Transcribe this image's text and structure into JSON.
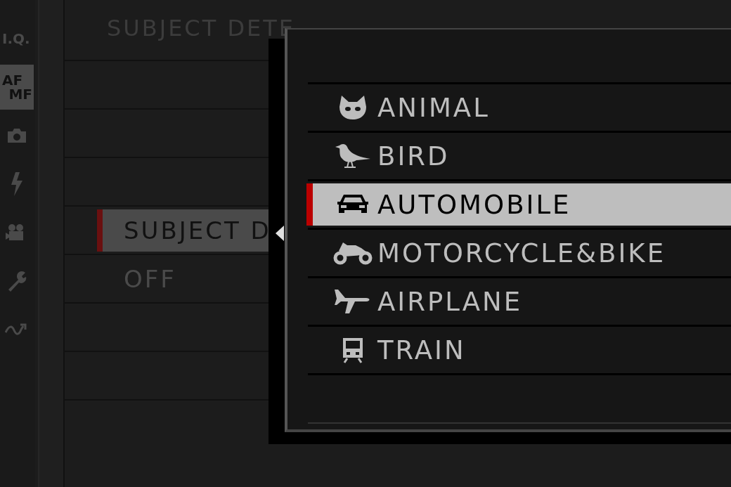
{
  "sidebar": {
    "items": [
      {
        "kind": "text",
        "lines": [
          "I.Q."
        ],
        "selected": false
      },
      {
        "kind": "text",
        "lines": [
          "AF",
          "MF"
        ],
        "selected": true
      },
      {
        "kind": "camera",
        "selected": false
      },
      {
        "kind": "flash",
        "selected": false
      },
      {
        "kind": "movie",
        "selected": false
      },
      {
        "kind": "wrench",
        "selected": false
      },
      {
        "kind": "wave",
        "selected": false
      }
    ]
  },
  "menu": {
    "title": "SUBJECT DETE",
    "items": [
      {
        "label": "SUBJECT D",
        "selected": true
      },
      {
        "label": "OFF",
        "selected": false
      }
    ]
  },
  "popup": {
    "items": [
      {
        "kind": "animal",
        "label": "ANIMAL",
        "selected": false
      },
      {
        "kind": "bird",
        "label": "BIRD",
        "selected": false
      },
      {
        "kind": "car",
        "label": "AUTOMOBILE",
        "selected": true
      },
      {
        "kind": "motorcycle",
        "label": "MOTORCYCLE&BIKE",
        "selected": false
      },
      {
        "kind": "airplane",
        "label": "AIRPLANE",
        "selected": false
      },
      {
        "kind": "train",
        "label": "TRAIN",
        "selected": false
      }
    ]
  }
}
